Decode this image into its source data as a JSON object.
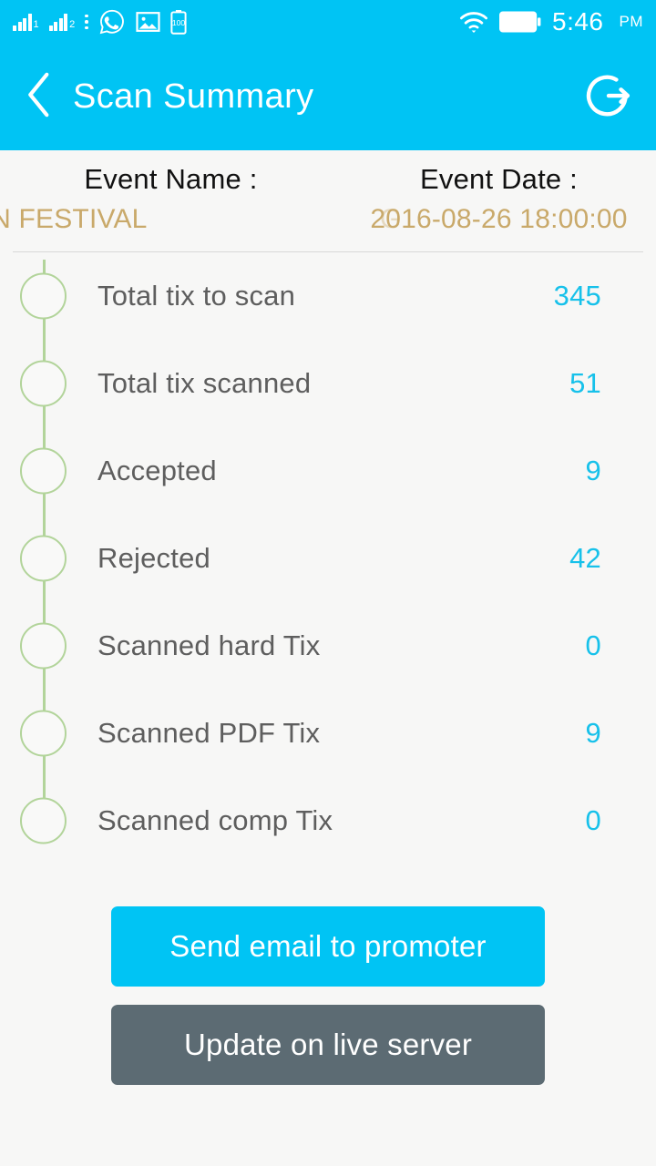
{
  "status_bar": {
    "signal_1_label": "1",
    "signal_2_label": "2",
    "icons": [
      "signal-bars-1-icon",
      "signal-bars-2-icon",
      "more-vertical-icon",
      "whatsapp-icon",
      "gallery-image-icon",
      "battery-saver-icon",
      "wifi-icon",
      "battery-full-icon"
    ],
    "battery_level_text": "100",
    "time": "5:46",
    "am_pm": "PM"
  },
  "app_bar": {
    "back_icon": "chevron-left-icon",
    "title": "Scan Summary",
    "logout_icon": "logout-icon"
  },
  "event_header": {
    "name_label": "Event Name :",
    "name_value": "DEN FESTIVAL",
    "name_marquee_ghost": "G",
    "date_label": "Event Date :",
    "date_value": "2016-08-26 18:00:00"
  },
  "summary": {
    "rows": [
      {
        "label": "Total tix to scan",
        "value": "345"
      },
      {
        "label": "Total tix scanned",
        "value": "51"
      },
      {
        "label": "Accepted",
        "value": "9"
      },
      {
        "label": "Rejected",
        "value": "42"
      },
      {
        "label": "Scanned hard Tix",
        "value": "0"
      },
      {
        "label": "Scanned PDF Tix",
        "value": "9"
      },
      {
        "label": "Scanned comp Tix",
        "value": "0"
      }
    ]
  },
  "actions": {
    "send_email_label": "Send email to promoter",
    "update_server_label": "Update on live server"
  },
  "colors": {
    "accent_cyan": "#00c4f4",
    "value_cyan": "#17c1ea",
    "timeline_green": "#b2d49a",
    "event_gold": "#c9a96a",
    "secondary_gray": "#5c6b73",
    "label_gray": "#5e5e5e",
    "page_background": "#f7f7f6"
  }
}
